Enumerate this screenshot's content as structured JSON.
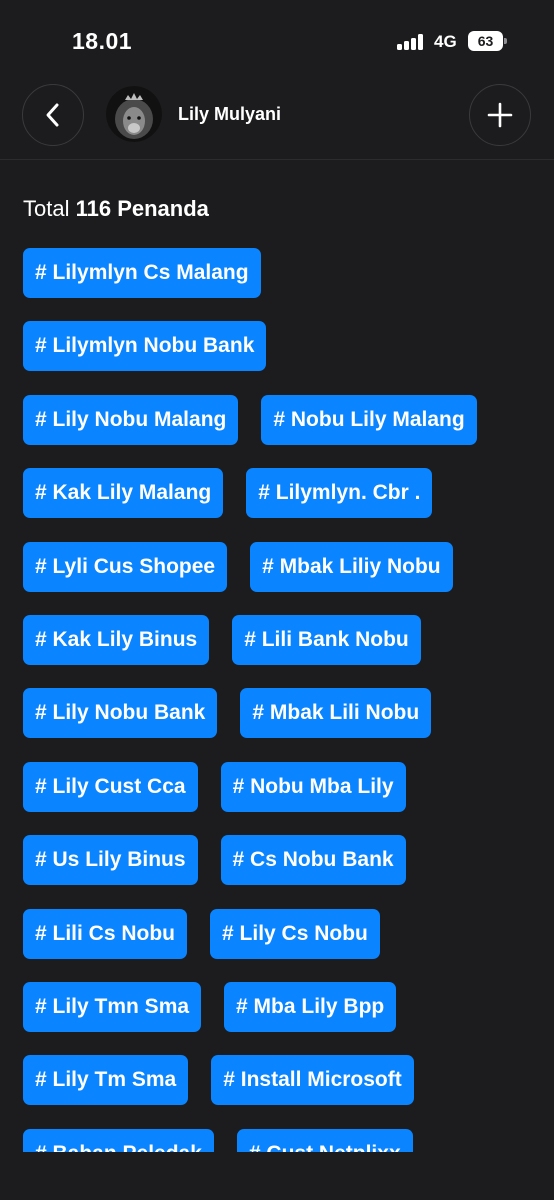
{
  "status_bar": {
    "time": "18.01",
    "network": "4G",
    "battery": "63"
  },
  "header": {
    "profile_name": "Lily Mulyani"
  },
  "total": {
    "prefix": "Total",
    "count_label": "116 Penanda"
  },
  "tags": [
    [
      "# Lilymlyn Cs Malang"
    ],
    [
      "# Lilymlyn Nobu Bank"
    ],
    [
      "# Lily Nobu Malang",
      "# Nobu Lily Malang"
    ],
    [
      "# Kak Lily Malang",
      "# Lilymlyn. Cbr ."
    ],
    [
      "# Lyli Cus Shopee",
      "# Mbak Liliy Nobu"
    ],
    [
      "# Kak Lily Binus",
      "# Lili Bank Nobu"
    ],
    [
      "# Lily Nobu Bank",
      "# Mbak Lili Nobu"
    ],
    [
      "# Lily Cust Cca",
      "# Nobu Mba Lily"
    ],
    [
      "# Us Lily Binus",
      "# Cs Nobu Bank"
    ],
    [
      "# Lili Cs Nobu",
      "# Lily Cs Nobu"
    ],
    [
      "# Lily Tmn Sma",
      "# Mba Lily Bpp"
    ],
    [
      "# Lily Tm Sma",
      "# Install Microsoft"
    ],
    [
      "# Bahan Peledak",
      "# Cust Netplixx"
    ]
  ],
  "colors": {
    "background": "#1c1c1e",
    "tag": "#0a84ff"
  }
}
